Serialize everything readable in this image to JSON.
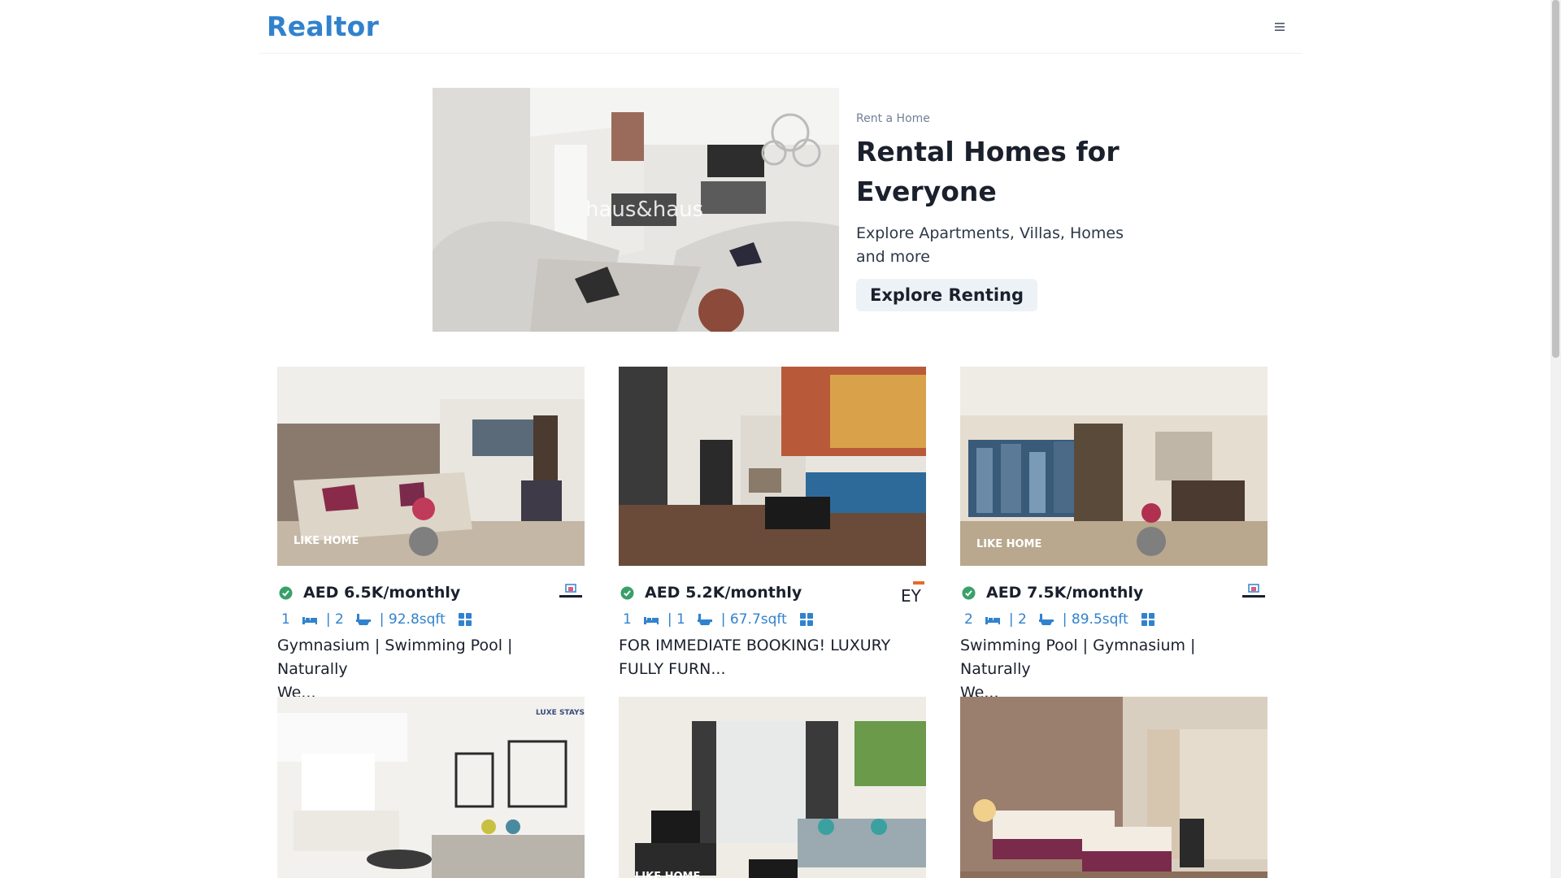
{
  "nav": {
    "logo": "Realtor"
  },
  "hero": {
    "eyebrow": "Rent a Home",
    "title_line1": "Rental Homes for",
    "title_line2": "Everyone",
    "desc_line1": "Explore Apartments, Villas, Homes",
    "desc_line2": "and more",
    "button": "Explore Renting",
    "image_watermark": "haus&haus"
  },
  "listings": [
    {
      "price": "AED 6.5K/monthly",
      "rooms": "1",
      "baths": "| 2",
      "area": "| 92.8sqft",
      "title_line1": "Gymnasium | Swimming Pool | Naturally",
      "title_line2": "We...",
      "watermark": "LIKE HOME",
      "agency": "like-home-logo"
    },
    {
      "price": "AED 5.2K/monthly",
      "rooms": "1",
      "baths": "| 1",
      "area": "| 67.7sqft",
      "title_line1": "FOR IMMEDIATE BOOKING! LUXURY",
      "title_line2": "FULLY FURN...",
      "agency": "ey-logo",
      "agency_text": "EY"
    },
    {
      "price": "AED 7.5K/monthly",
      "rooms": "2",
      "baths": "| 2",
      "area": "| 89.5sqft",
      "title_line1": "Swimming Pool | Gymnasium | Naturally",
      "title_line2": "We...",
      "watermark": "LIKE HOME",
      "agency": "like-home-logo"
    },
    {
      "watermark": "LUXE STAYS"
    },
    {
      "watermark": "LIKE HOME"
    },
    {}
  ],
  "colors": {
    "brand": "#3182ce",
    "verified": "#38a169",
    "text": "#1a202c"
  }
}
